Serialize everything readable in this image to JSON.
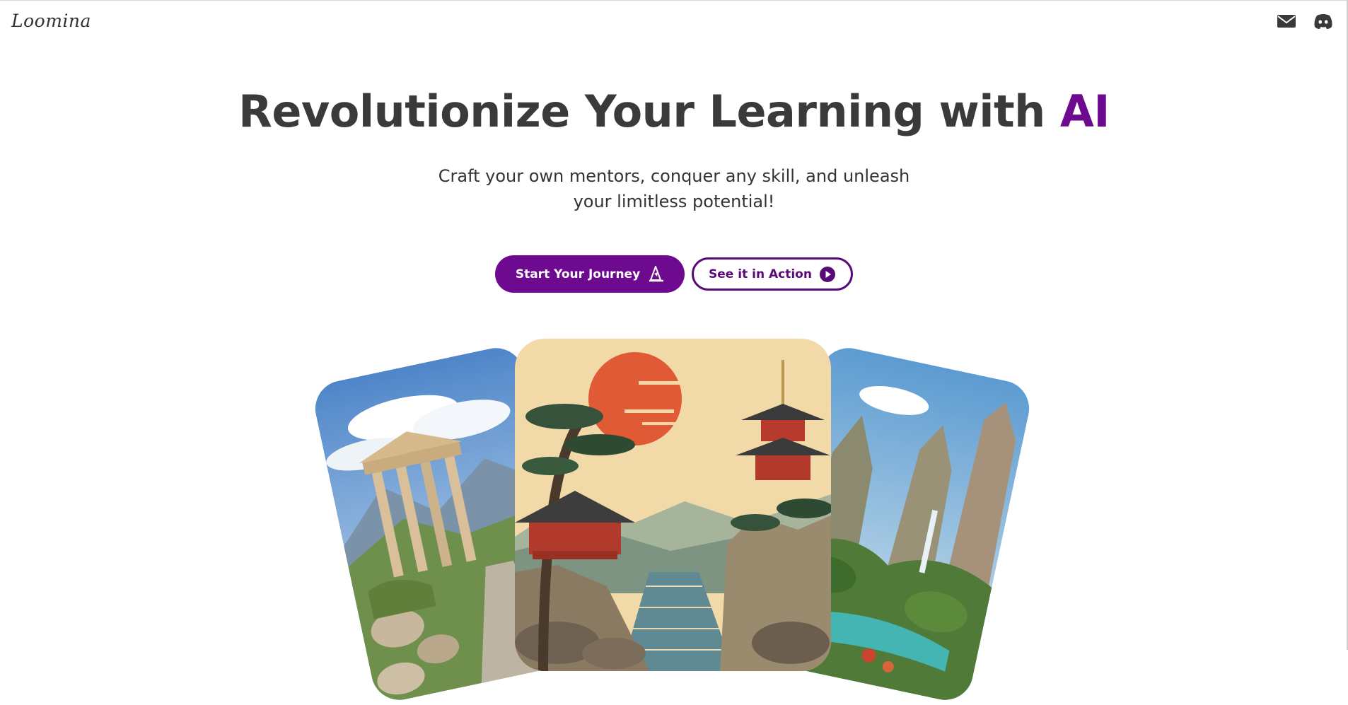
{
  "header": {
    "logo_text": "Loomina",
    "icons": [
      "mail-icon",
      "discord-icon"
    ]
  },
  "hero": {
    "title_main": "Revolutionize Your Learning with ",
    "title_accent": "AI",
    "subtitle_line1": "Craft your own mentors, conquer any skill, and unleash",
    "subtitle_line2": "your limitless potential!",
    "primary_cta": "Start Your Journey",
    "secondary_cta": "See it in Action"
  },
  "colors": {
    "accent": "#6d0a8f",
    "text": "#3a3a3a",
    "background": "#ffffff"
  },
  "gallery": {
    "cards": [
      "greek-ruins-illustration",
      "japanese-pagoda-illustration",
      "tropical-cliffs-illustration"
    ]
  }
}
